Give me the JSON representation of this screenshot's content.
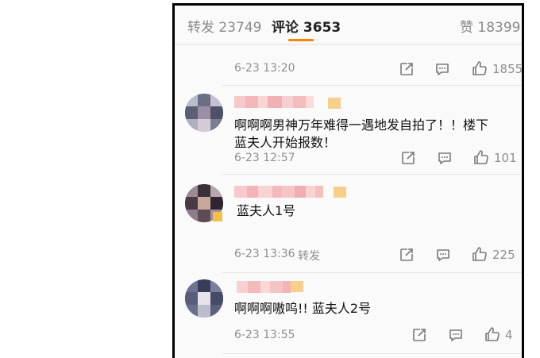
{
  "tabs": {
    "repost": "转发 23749",
    "comments": "评论 3653",
    "likes": "赞 18399"
  },
  "accent_color": "#ff8200",
  "top_comment": {
    "time": "6-23 13:20",
    "like_count": "1855"
  },
  "comments": [
    {
      "text_line1": "啊啊啊男神万年难得一遇地发自拍了！！楼下",
      "text_line2": "蓝夫人开始报数！",
      "time": "6-23 12:57",
      "like_count": "101"
    },
    {
      "text_line1": "蓝夫人1号",
      "time": "6-23 13:36",
      "repost_label": "转发",
      "like_count": "225"
    },
    {
      "text_line1": "啊啊啊嗷呜!! 蓝夫人2号",
      "time": "6-23 13:55",
      "like_count": "4"
    }
  ],
  "icons": {
    "share": "share-icon",
    "comment": "comment-icon",
    "like": "thumbs-up-icon"
  }
}
